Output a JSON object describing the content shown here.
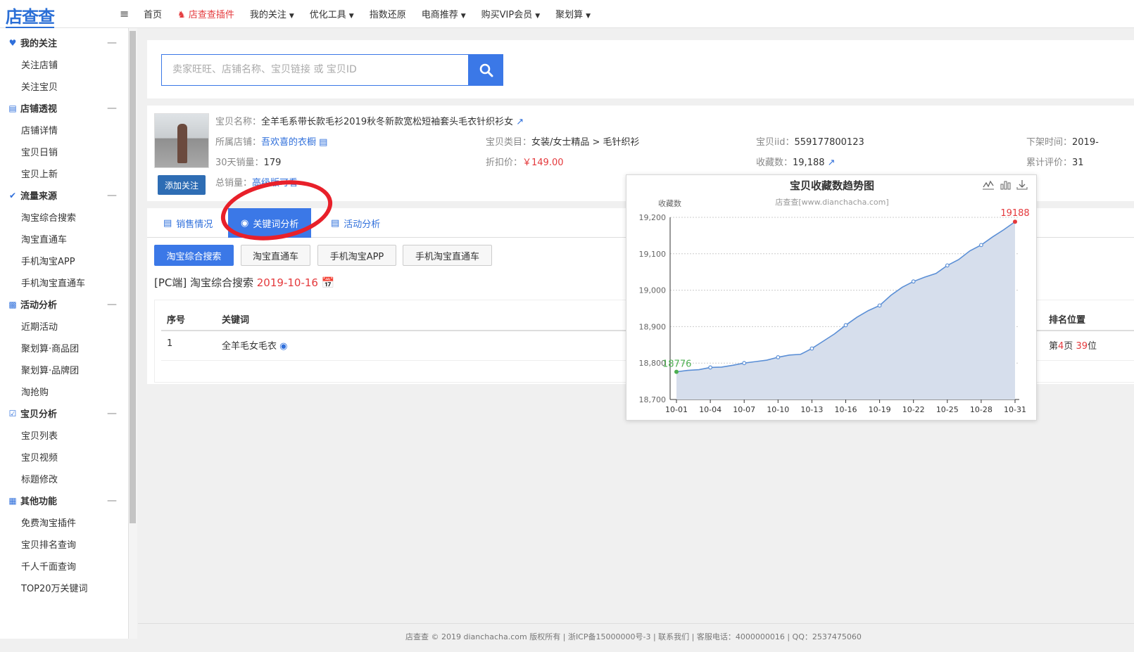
{
  "header": {
    "logo": "店查查",
    "menu_icon": "≡",
    "nav": [
      {
        "label": "首页"
      },
      {
        "label": "店查查插件"
      },
      {
        "label": "我的关注"
      },
      {
        "label": "优化工具"
      },
      {
        "label": "指数还原"
      },
      {
        "label": "电商推荐"
      },
      {
        "label": "购买VIP会员"
      },
      {
        "label": "聚划算"
      }
    ],
    "caret": "▼"
  },
  "sidebar": {
    "groups": [
      {
        "label": "我的关注",
        "icon": "heart-icon",
        "items": [
          "关注店铺",
          "关注宝贝"
        ]
      },
      {
        "label": "店铺透视",
        "icon": "shop-icon",
        "items": [
          "店铺详情",
          "宝贝日销",
          "宝贝上新"
        ]
      },
      {
        "label": "流量来源",
        "icon": "check-circle-icon",
        "items": [
          "淘宝综合搜索",
          "淘宝直通车",
          "手机淘宝APP",
          "手机淘宝直通车"
        ]
      },
      {
        "label": "活动分析",
        "icon": "bar-chart-icon",
        "items": [
          "近期活动",
          "聚划算·商品团",
          "聚划算·品牌团",
          "淘抢购"
        ]
      },
      {
        "label": "宝贝分析",
        "icon": "check-square-icon",
        "items": [
          "宝贝列表",
          "宝贝视频",
          "标题修改"
        ]
      },
      {
        "label": "其他功能",
        "icon": "grid-icon",
        "items": [
          "免费淘宝插件",
          "宝贝排名查询",
          "千人千面查询",
          "TOP20万关键词"
        ]
      }
    ],
    "collapse_symbol": "—"
  },
  "search": {
    "placeholder": "卖家旺旺、店铺名称、宝贝链接 或 宝贝ID"
  },
  "product": {
    "name_label": "宝贝名称：",
    "name": "全羊毛系带长款毛衫2019秋冬新款宽松短袖套头毛衣针织衫女",
    "shop_label": "所属店铺：",
    "shop": "吾欢喜的衣橱",
    "sales30_label": "30天销量：",
    "sales30": "179",
    "total_sales_label": "总销量：",
    "total_sales": "高级版可看",
    "category_label": "宝贝类目：",
    "category": "女装/女士精品 > 毛针织衫",
    "discount_label": "折扣价：",
    "discount_price": "￥149.00",
    "iid_label": "宝贝iid：",
    "iid": "559177800123",
    "fav_label": "收藏数：",
    "fav": "19,188",
    "offshelf_label": "下架时间：",
    "offshelf": "2019-",
    "reviews_label": "累计评价：",
    "reviews": "31",
    "follow_button": "添加关注"
  },
  "tabs": [
    {
      "label": "销售情况"
    },
    {
      "label": "关键词分析"
    },
    {
      "label": "活动分析"
    }
  ],
  "subtabs": [
    "淘宝综合搜索",
    "淘宝直通车",
    "手机淘宝APP",
    "手机淘宝直通车"
  ],
  "section": {
    "prefix": "[PC端] 淘宝综合搜索 ",
    "date": "2019-10-16"
  },
  "table": {
    "headers": {
      "index": "序号",
      "keyword": "关键词",
      "rank": "排名位置"
    },
    "rows": [
      {
        "index": "1",
        "keyword": "全羊毛女毛衣",
        "rank_prefix": "第",
        "rank_page": "4",
        "rank_mid": "页 ",
        "rank_pos": "39",
        "rank_suffix": "位"
      }
    ]
  },
  "footer": {
    "text": "店查查 © 2019 dianchacha.com 版权所有 | 浙ICP备15000000号-3 | 联系我们 | 客服电话：4000000016 | QQ：2537475060"
  },
  "chart_data": {
    "type": "area",
    "title": "宝贝收藏数趋势图",
    "subtitle": "店查查[www.dianchacha.com]",
    "ylabel": "收藏数",
    "xlabel": "",
    "ylim": [
      18700,
      19200
    ],
    "yticks": [
      18700,
      18800,
      18900,
      19000,
      19100,
      19200
    ],
    "ytick_labels": [
      "18,700",
      "18,800",
      "18,900",
      "19,000",
      "19,100",
      "19,200"
    ],
    "xtick_labels": [
      "10-01",
      "10-04",
      "10-07",
      "10-10",
      "10-13",
      "10-16",
      "10-19",
      "10-22",
      "10-25",
      "10-28",
      "10-31"
    ],
    "x": [
      "10-01",
      "10-02",
      "10-03",
      "10-04",
      "10-05",
      "10-06",
      "10-07",
      "10-08",
      "10-09",
      "10-10",
      "10-11",
      "10-12",
      "10-13",
      "10-14",
      "10-15",
      "10-16",
      "10-17",
      "10-18",
      "10-19",
      "10-20",
      "10-21",
      "10-22",
      "10-23",
      "10-24",
      "10-25",
      "10-26",
      "10-27",
      "10-28",
      "10-29",
      "10-30",
      "10-31"
    ],
    "values": [
      18776,
      18780,
      18782,
      18788,
      18789,
      18794,
      18800,
      18804,
      18808,
      18816,
      18822,
      18824,
      18840,
      18860,
      18880,
      18904,
      18926,
      18944,
      18958,
      18986,
      19008,
      19024,
      19036,
      19046,
      19068,
      19084,
      19108,
      19124,
      19146,
      19166,
      19188
    ],
    "min_label": "18776",
    "max_label": "19188",
    "min_color": "#4caf50",
    "max_color": "#e4393c",
    "line_color": "#5b8fd6",
    "fill_color": "#d6deec",
    "grid": true
  }
}
